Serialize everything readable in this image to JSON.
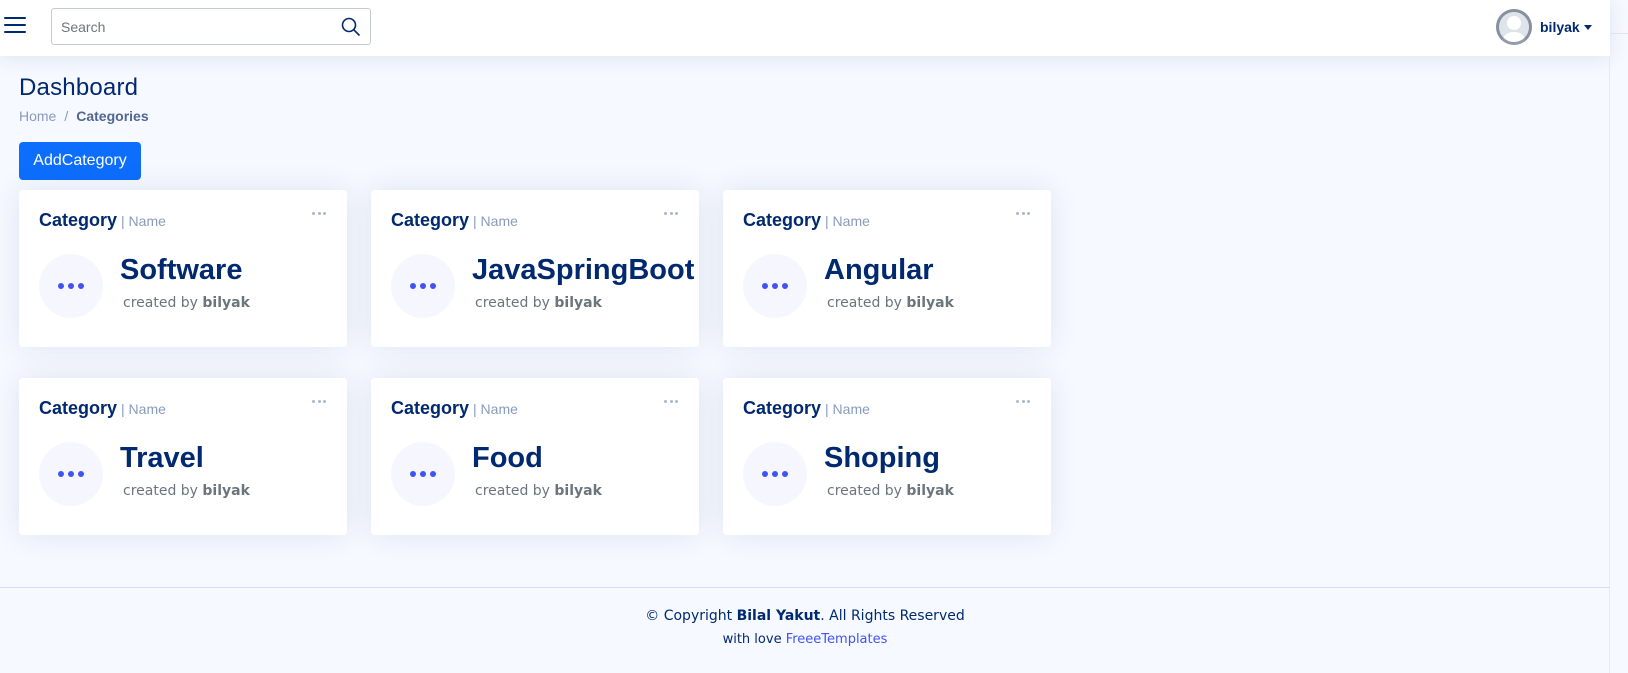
{
  "header": {
    "search": {
      "placeholder": "Search",
      "value": ""
    },
    "user": {
      "name": "bilyak"
    }
  },
  "page": {
    "title": "Dashboard",
    "breadcrumb": {
      "home": "Home",
      "separator": "/",
      "current": "Categories"
    },
    "add_button": "AddCategory"
  },
  "cards": [
    {
      "title": "Category",
      "subtitle": "| Name",
      "name": "Software",
      "created_prefix": "created by",
      "author": "bilyak"
    },
    {
      "title": "Category",
      "subtitle": "| Name",
      "name": "JavaSpringBoot",
      "created_prefix": "created by",
      "author": "bilyak"
    },
    {
      "title": "Category",
      "subtitle": "| Name",
      "name": "Angular",
      "created_prefix": "created by",
      "author": "bilyak"
    },
    {
      "title": "Category",
      "subtitle": "| Name",
      "name": "Travel",
      "created_prefix": "created by",
      "author": "bilyak"
    },
    {
      "title": "Category",
      "subtitle": "| Name",
      "name": "Food",
      "created_prefix": "created by",
      "author": "bilyak"
    },
    {
      "title": "Category",
      "subtitle": "| Name",
      "name": "Shoping",
      "created_prefix": "created by",
      "author": "bilyak"
    }
  ],
  "footer": {
    "copyright_prefix": "© Copyright",
    "owner": "Bilal Yakut",
    "copyright_suffix": ". All Rights Reserved",
    "love_prefix": "with love",
    "credit_link": "FreeeTemplates"
  },
  "colors": {
    "primary": "#0d6efd",
    "brand_dark": "#012970",
    "accent": "#4154f1",
    "page_bg": "#f6f9ff"
  },
  "icons": [
    "menu-icon",
    "search-icon",
    "avatar-icon",
    "caret-down-icon",
    "more-dots-icon"
  ]
}
